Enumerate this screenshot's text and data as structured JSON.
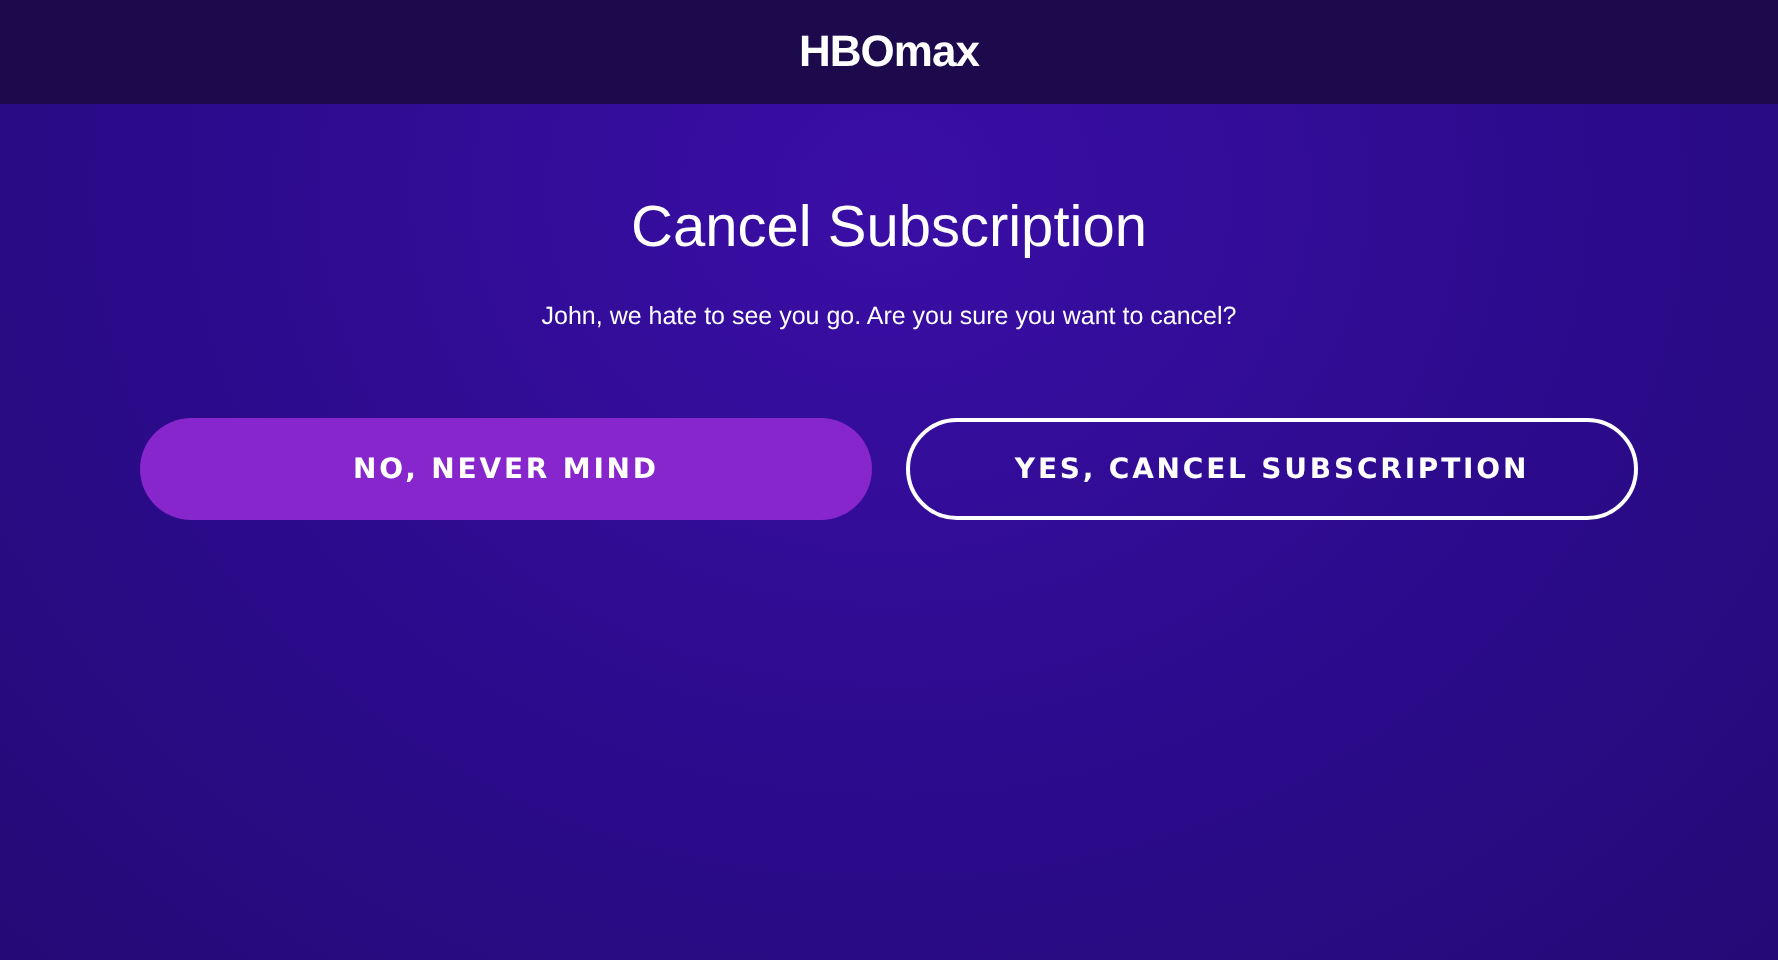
{
  "header": {
    "logo": "HBOmax"
  },
  "title": "Cancel Subscription",
  "message": "John, we hate to see you go. Are you sure you want to cancel?",
  "buttons": [
    {
      "label": "NO, NEVER MIND",
      "kind": "primary"
    },
    {
      "label": "YES, CANCEL SUBSCRIPTION",
      "kind": "outline"
    }
  ]
}
